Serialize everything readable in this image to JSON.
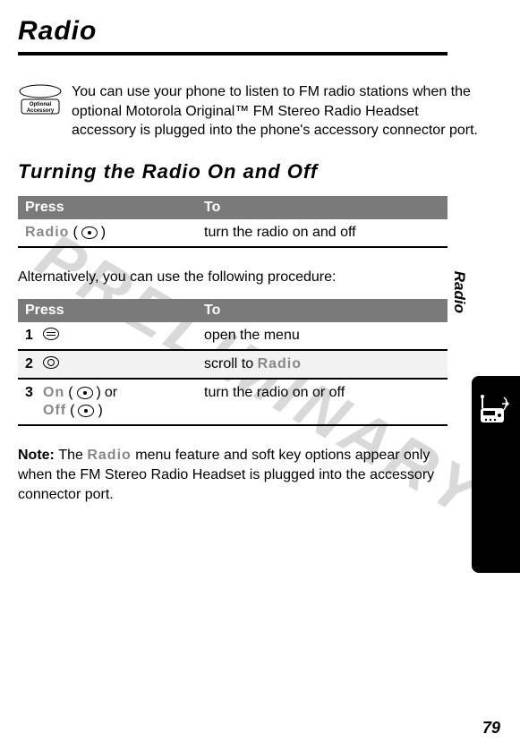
{
  "page": {
    "title": "Radio",
    "intro": "You can use your phone to listen to FM radio stations when the optional Motorola Original™ FM Stereo Radio Headset accessory is plugged into the phone's accessory connector port.",
    "subheading": "Turning the Radio On and Off",
    "watermark": "PRELIMINARY",
    "side_label": "Radio",
    "page_number": "79"
  },
  "table1": {
    "head_press": "Press",
    "head_to": "To",
    "row1": {
      "label": "Radio",
      "to": "turn the radio on and off"
    }
  },
  "alt_text": "Alternatively, you can use the following procedure:",
  "table2": {
    "head_press": "Press",
    "head_to": "To",
    "rows": [
      {
        "num": "1",
        "to": "open the menu"
      },
      {
        "num": "2",
        "to_prefix": "scroll to ",
        "to_label": "Radio"
      },
      {
        "num": "3",
        "label_on": "On",
        "label_or": " or",
        "label_off": "Off",
        "to": "turn the radio on or off"
      }
    ]
  },
  "note": {
    "prefix": "Note: ",
    "before": "The ",
    "label": "Radio",
    "after": " menu feature and soft key options appear only when the FM Stereo Radio Headset is plugged into the accessory connector port."
  },
  "accessory_badge": "Optional Accessory"
}
